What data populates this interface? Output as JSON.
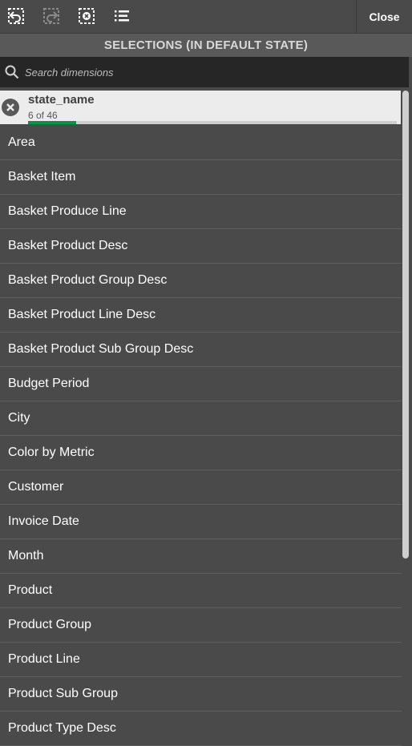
{
  "toolbar": {
    "icons": [
      "step-back-icon",
      "step-forward-icon",
      "clear-all-selections-icon",
      "selections-list-icon"
    ],
    "close_label": "Close"
  },
  "panel": {
    "title": "SELECTIONS (IN DEFAULT STATE)"
  },
  "search": {
    "placeholder": "Search dimensions"
  },
  "selection": {
    "field": "state_name",
    "count_text": "6 of 46",
    "selected_fraction": 0.13,
    "bar_color": "#009845"
  },
  "dimensions": [
    "Area",
    "Basket Item",
    "Basket Produce Line",
    "Basket Product Desc",
    "Basket Product Group Desc",
    "Basket Product Line Desc",
    "Basket Product Sub Group Desc",
    "Budget Period",
    "City",
    "Color by Metric",
    "Customer",
    "Invoice Date",
    "Month",
    "Product",
    "Product Group",
    "Product Line",
    "Product Sub Group",
    "Product Type Desc"
  ],
  "colors": {
    "background": "#4a4a4a",
    "header": "#595959",
    "search": "#262626",
    "card": "#ececec",
    "accent": "#009845"
  }
}
